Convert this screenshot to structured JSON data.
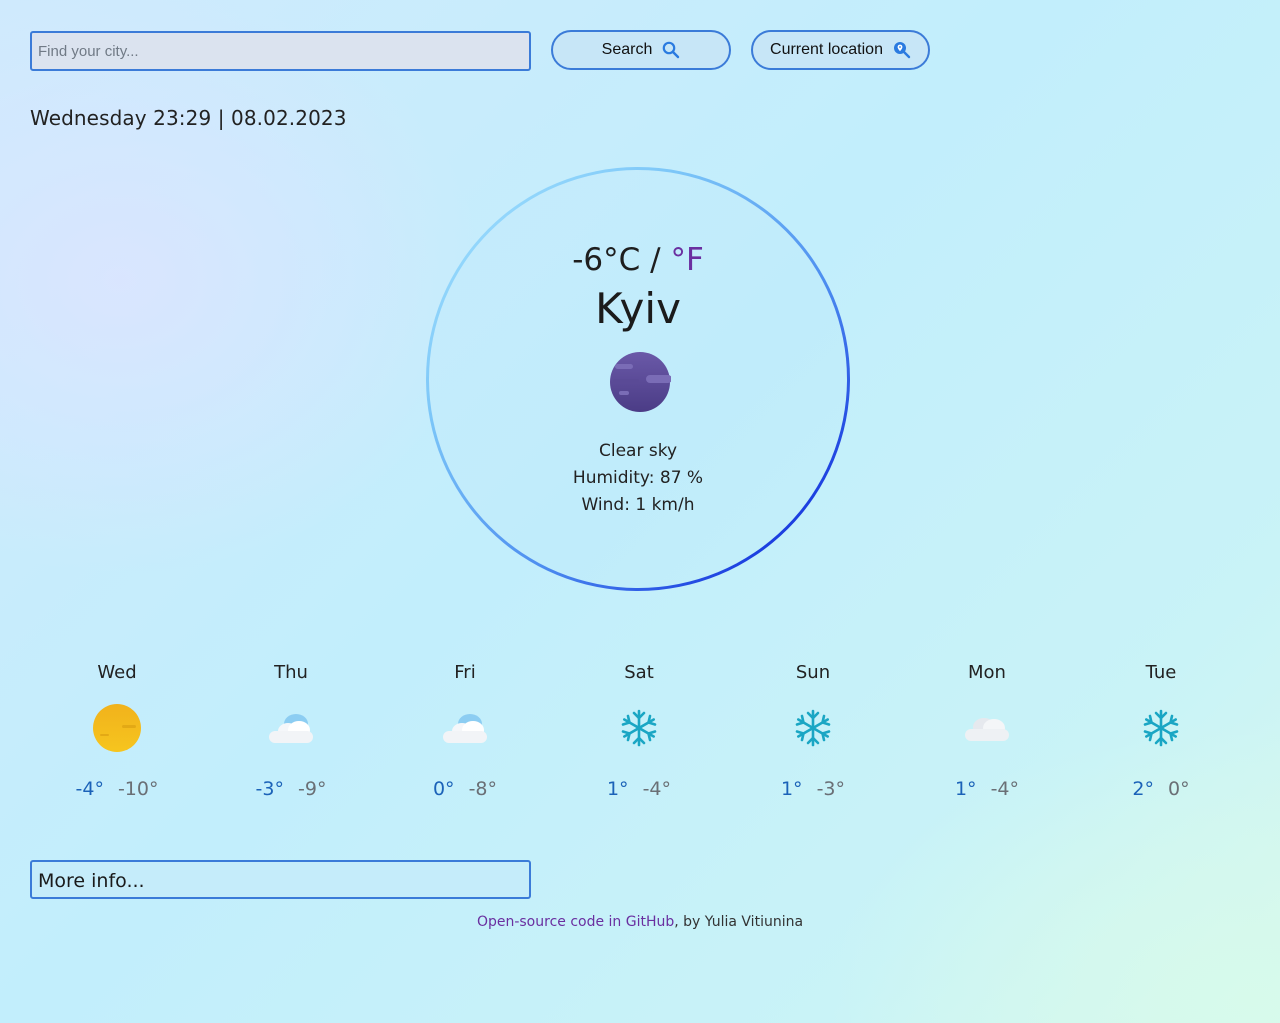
{
  "search": {
    "placeholder": "Find your city...",
    "value": ""
  },
  "buttons": {
    "search_label": "Search",
    "location_label": "Current location"
  },
  "datetime": "Wednesday 23:29 | 08.02.2023",
  "current": {
    "temp": "-6",
    "unit_c": "°C",
    "separator": " / ",
    "unit_f": "°F",
    "city": "Kyiv",
    "icon": "moon-icon",
    "description": "Clear sky",
    "humidity": "Humidity: 87 %",
    "wind": "Wind: 1 km/h"
  },
  "forecast": [
    {
      "day": "Wed",
      "icon": "sun-icon",
      "max": "-4°",
      "min": "-10°"
    },
    {
      "day": "Thu",
      "icon": "cloud-icon",
      "max": "-3°",
      "min": "-9°"
    },
    {
      "day": "Fri",
      "icon": "cloud-icon",
      "max": "0°",
      "min": "-8°"
    },
    {
      "day": "Sat",
      "icon": "snowflake-icon",
      "max": "1°",
      "min": "-4°"
    },
    {
      "day": "Sun",
      "icon": "snowflake-icon",
      "max": "1°",
      "min": "-3°"
    },
    {
      "day": "Mon",
      "icon": "cloud-icon",
      "max": "1°",
      "min": "-4°"
    },
    {
      "day": "Tue",
      "icon": "snowflake-icon",
      "max": "2°",
      "min": "0°"
    }
  ],
  "more_info": "More info...",
  "footer": {
    "link_text": "Open-source code in GitHub",
    "suffix": ", by Yulia Vitiunina"
  },
  "colors": {
    "accent_border": "#3b7bd8",
    "link": "#6a2fa0",
    "max_temp": "#1b62b8"
  }
}
